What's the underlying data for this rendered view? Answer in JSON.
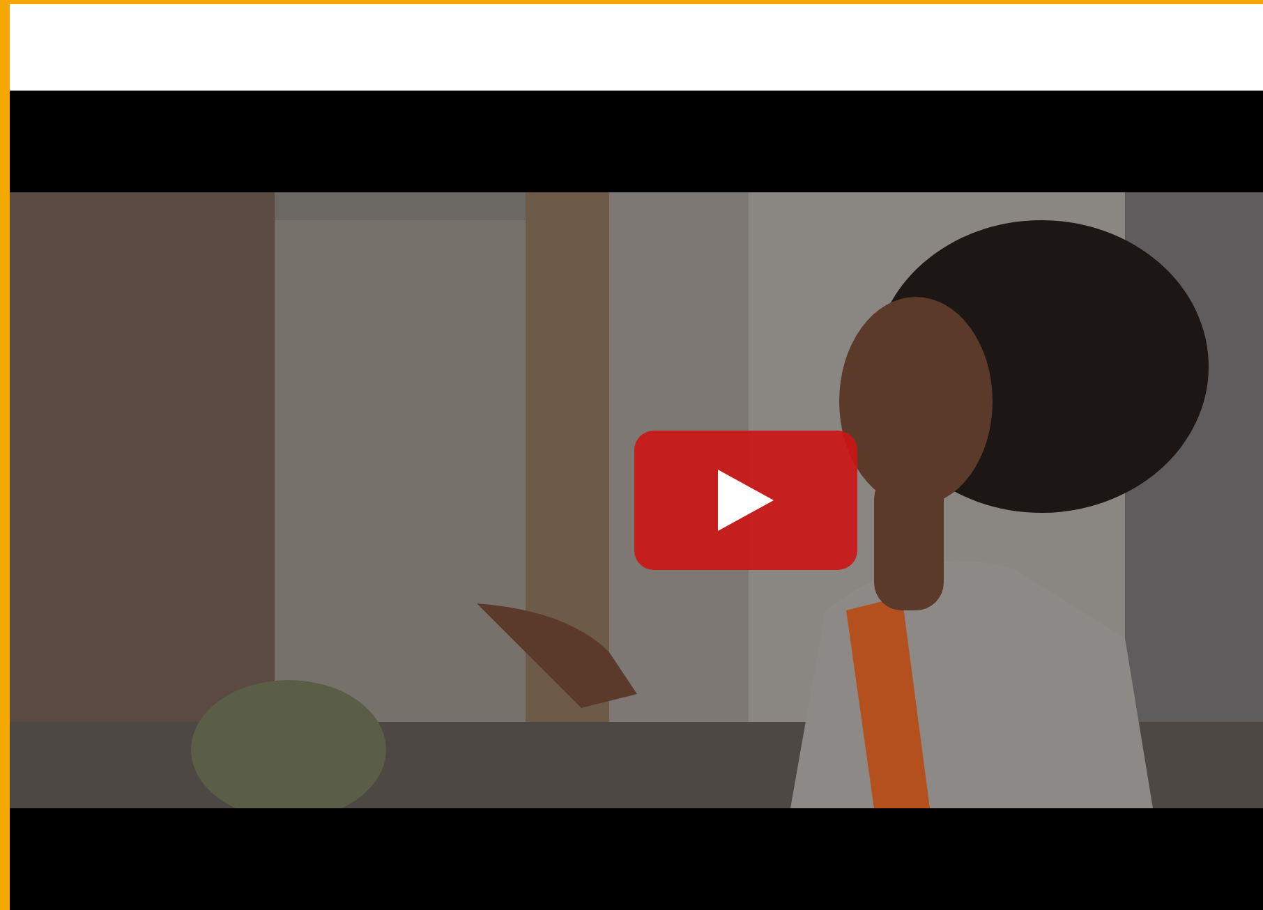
{
  "video_player": {
    "kind": "picture",
    "play_button": true
  }
}
